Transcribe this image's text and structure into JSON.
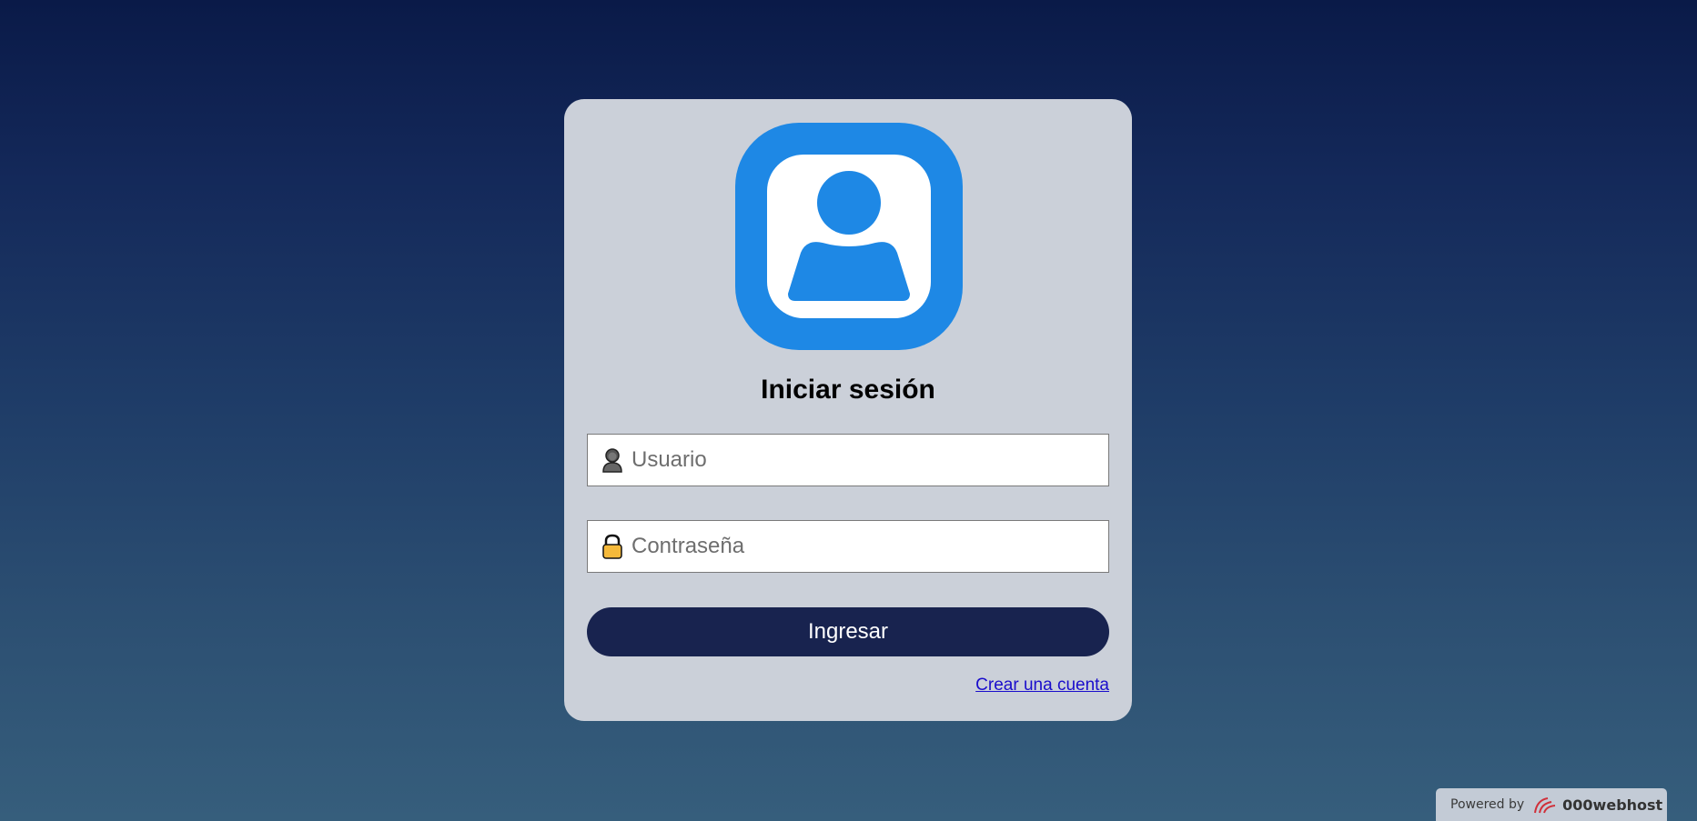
{
  "login": {
    "title": "Iniciar sesión",
    "username_placeholder": "Usuario",
    "username_value": "",
    "password_placeholder": "Contraseña",
    "password_value": "",
    "submit_label": "Ingresar",
    "create_account_label": "Crear una cuenta",
    "logo_icon": "user-avatar-icon"
  },
  "footer_badge": {
    "powered_label": "Powered by",
    "brand_name": "000webhost"
  },
  "colors": {
    "card_background": "#cbd0d9",
    "logo_blue": "#1e88e5",
    "button_background": "#18234f",
    "link_color": "#1a0dcc"
  }
}
